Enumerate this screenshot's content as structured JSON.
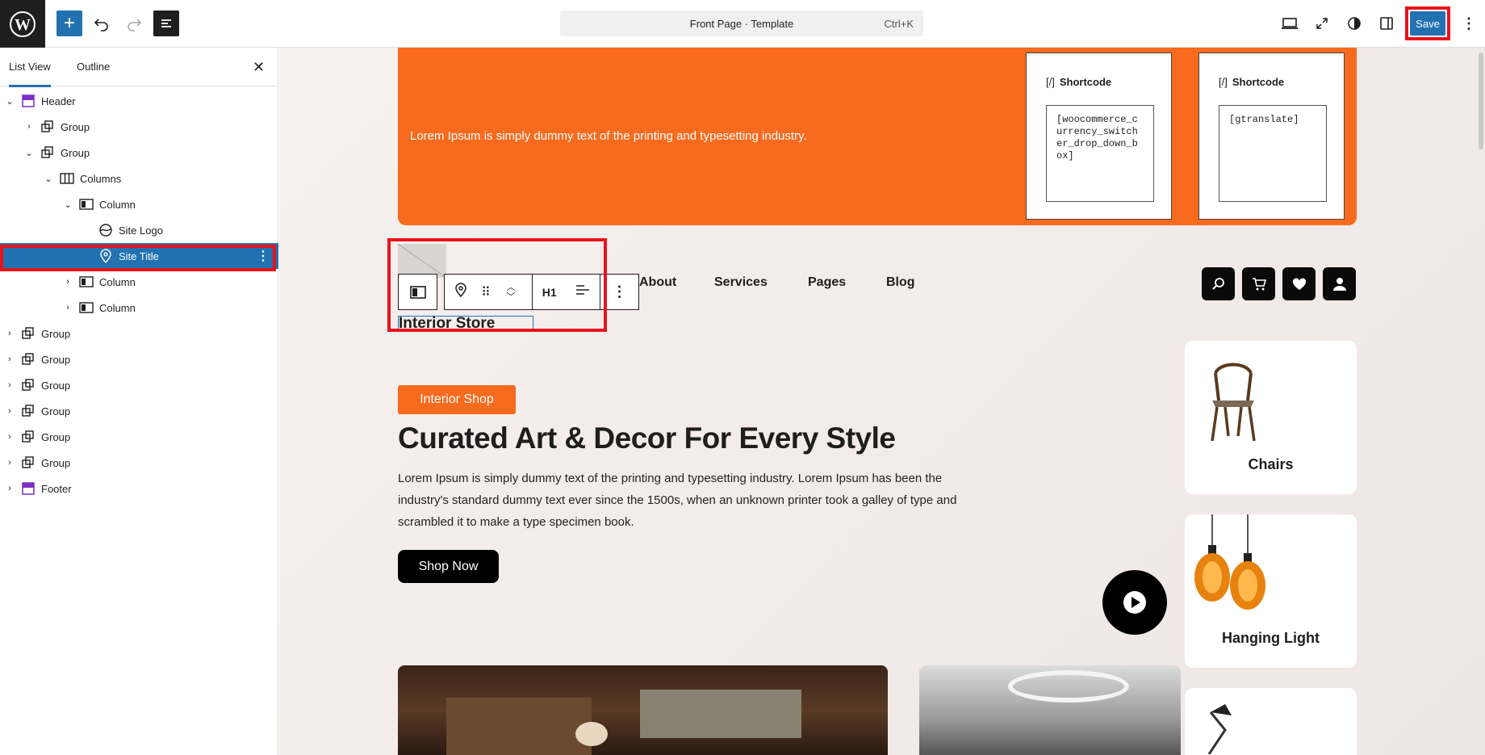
{
  "topbar": {
    "command_title": "Front Page · Template",
    "command_shortcut": "Ctrl+K",
    "save_label": "Save"
  },
  "sidebar": {
    "tabs": [
      "List View",
      "Outline"
    ],
    "items": [
      {
        "label": "Header",
        "icon": "template-part-icon"
      },
      {
        "label": "Group",
        "icon": "group-icon"
      },
      {
        "label": "Group",
        "icon": "group-icon"
      },
      {
        "label": "Columns",
        "icon": "columns-icon"
      },
      {
        "label": "Column",
        "icon": "column-icon"
      },
      {
        "label": "Site Logo",
        "icon": "site-logo-icon"
      },
      {
        "label": "Site Title",
        "icon": "map-marker-icon"
      },
      {
        "label": "Column",
        "icon": "column-icon"
      },
      {
        "label": "Column",
        "icon": "column-icon"
      },
      {
        "label": "Group",
        "icon": "group-icon"
      },
      {
        "label": "Group",
        "icon": "group-icon"
      },
      {
        "label": "Group",
        "icon": "group-icon"
      },
      {
        "label": "Group",
        "icon": "group-icon"
      },
      {
        "label": "Group",
        "icon": "group-icon"
      },
      {
        "label": "Group",
        "icon": "group-icon"
      },
      {
        "label": "Footer",
        "icon": "template-part-icon"
      }
    ]
  },
  "canvas": {
    "banner_text": "Lorem Ipsum is simply dummy text of the printing and typesetting industry.",
    "shortcodes": [
      {
        "heading": "Shortcode",
        "code": "[woocommerce_currency_switcher_drop_down_box]"
      },
      {
        "heading": "Shortcode",
        "code": "[gtranslate]"
      }
    ],
    "nav": [
      "About",
      "Services",
      "Pages",
      "Blog"
    ],
    "site_title": "Interior Store",
    "toolbar_heading_level": "H1",
    "hero": {
      "badge": "Interior Shop",
      "title": "Curated Art & Decor For Every Style",
      "body": "Lorem Ipsum is simply dummy text of the printing and typesetting industry. Lorem Ipsum has been the industry's standard dummy text ever since the 1500s, when an unknown printer took a galley of type and scrambled it to make a type specimen book.",
      "button": "Shop Now"
    },
    "categories": [
      "Chairs",
      "Hanging Light"
    ],
    "colors": {
      "accent": "#f86a1d",
      "selection": "#2271b1",
      "highlight": "#e8131b"
    }
  }
}
